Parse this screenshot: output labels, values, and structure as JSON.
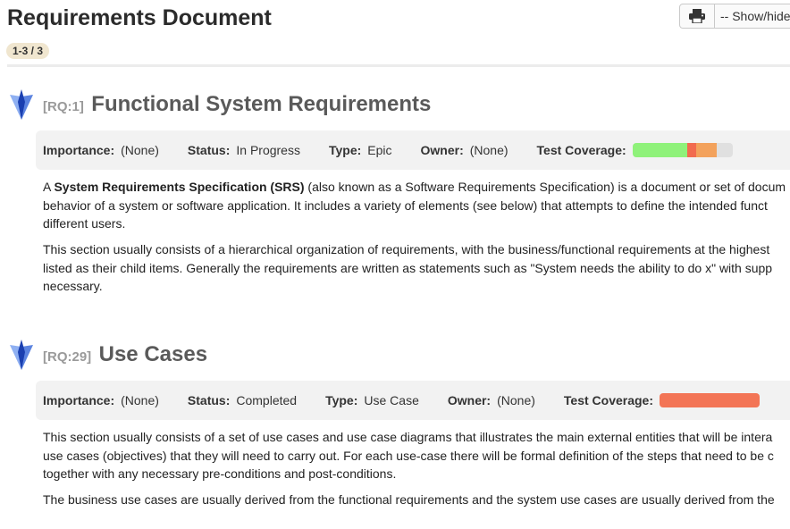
{
  "title": "Requirements Document",
  "toolbar": {
    "print_icon": "printer-icon",
    "showhide_label": "-- Show/hide"
  },
  "pager": "1-3 / 3",
  "colors": {
    "icon_light": "#7ea3f0",
    "icon_dark": "#1a3fb0",
    "covered": "#8ff27a",
    "failed": "#f26b4f",
    "blocked": "#f3a25c",
    "not_covered": "#e0e0e0"
  },
  "requirements": [
    {
      "key": "[RQ:1]",
      "name": "Functional System Requirements",
      "importance_label": "Importance:",
      "importance": "(None)",
      "status_label": "Status:",
      "status": "In Progress",
      "type_label": "Type:",
      "type": "Epic",
      "owner_label": "Owner:",
      "owner": "(None)",
      "coverage_label": "Test Coverage:",
      "coverage": {
        "passed": 0.55,
        "failed": 0.09,
        "blocked": 0.2,
        "not_run": 0.16
      },
      "p1_bold": "System Requirements Specification (SRS)",
      "p1_pre": "A ",
      "p1_post": " (also known as a Software Requirements Specification) is a document or set of docum",
      "p1_l2": "behavior of a system or software application. It includes a variety of elements (see below) that attempts to define the intended funct",
      "p1_l3": "different users.",
      "p2_l1": "This section usually consists of a hierarchical organization of requirements, with the business/functional requirements at the highest",
      "p2_l2": "listed as their child items. Generally the requirements are written as statements such as \"System needs the ability to do x\" with supp",
      "p2_l3": "necessary."
    },
    {
      "key": "[RQ:29]",
      "name": "Use Cases",
      "importance_label": "Importance:",
      "importance": "(None)",
      "status_label": "Status:",
      "status": "Completed",
      "type_label": "Type:",
      "type": "Use Case",
      "owner_label": "Owner:",
      "owner": "(None)",
      "coverage_label": "Test Coverage:",
      "coverage": {
        "failed": 1.0
      },
      "p1_l1": "This section usually consists of a set of use cases and use case diagrams that illustrates the main external entities that will be intera",
      "p1_l2": "use cases (objectives) that they will need to carry out. For each use-case there will be formal definition of the steps that need to be c",
      "p1_l3": "together with any necessary pre-conditions and post-conditions.",
      "p2_l1": "The business use cases are usually derived from the functional requirements and the system use cases are usually derived from the"
    }
  ]
}
